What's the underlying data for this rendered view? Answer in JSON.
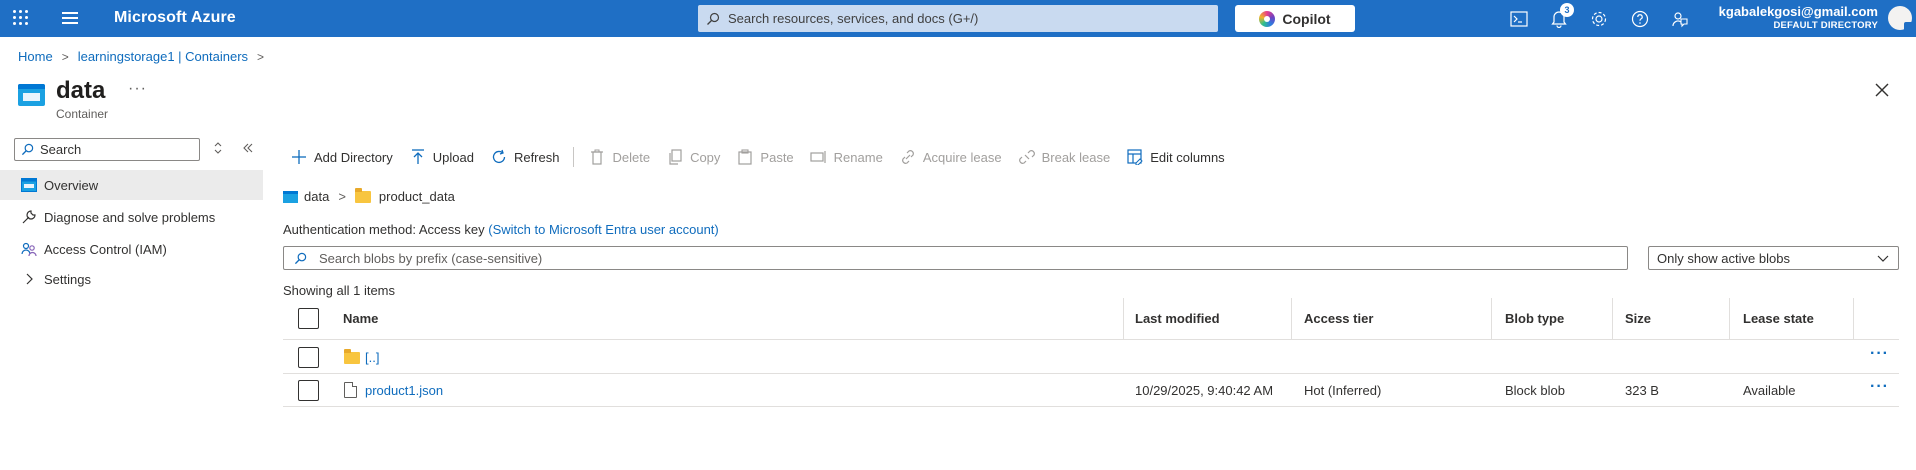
{
  "topbar": {
    "brand": "Microsoft Azure",
    "search_placeholder": "Search resources, services, and docs (G+/)",
    "copilot_label": "Copilot",
    "notification_count": "3",
    "account_email": "kgabalekgosi@gmail.com",
    "account_directory": "DEFAULT DIRECTORY"
  },
  "breadcrumb": {
    "home": "Home",
    "parent": "learningstorage1 | Containers"
  },
  "page": {
    "title": "data",
    "subtitle": "Container",
    "more": "···"
  },
  "sidebar": {
    "search_placeholder": "Search",
    "items": [
      {
        "label": "Overview",
        "icon": "overview-icon",
        "active": true
      },
      {
        "label": "Diagnose and solve problems",
        "icon": "wrench-icon"
      },
      {
        "label": "Access Control (IAM)",
        "icon": "people-icon"
      },
      {
        "label": "Settings",
        "icon": "chevron-right-icon"
      }
    ]
  },
  "toolbar": {
    "add_directory": "Add Directory",
    "upload": "Upload",
    "refresh": "Refresh",
    "delete": "Delete",
    "copy": "Copy",
    "paste": "Paste",
    "rename": "Rename",
    "acquire_lease": "Acquire lease",
    "break_lease": "Break lease",
    "edit_columns": "Edit columns"
  },
  "path": {
    "container": "data",
    "folder": "product_data"
  },
  "auth": {
    "label": "Authentication method:",
    "value": "Access key",
    "switch_link": "(Switch to Microsoft Entra user account)"
  },
  "blob_search": {
    "placeholder": "Search blobs by prefix (case-sensitive)"
  },
  "filter": {
    "selected": "Only show active blobs"
  },
  "showing": "Showing all 1 items",
  "table": {
    "columns": [
      "Name",
      "Last modified",
      "Access tier",
      "Blob type",
      "Size",
      "Lease state"
    ],
    "rows": [
      {
        "name": "[..]",
        "type": "folder",
        "last_modified": "",
        "access_tier": "",
        "blob_type": "",
        "size": "",
        "lease_state": ""
      },
      {
        "name": "product1.json",
        "type": "file",
        "last_modified": "10/29/2025, 9:40:42 AM",
        "access_tier": "Hot (Inferred)",
        "blob_type": "Block blob",
        "size": "323 B",
        "lease_state": "Available"
      }
    ],
    "row_more": "···"
  },
  "colors": {
    "topbar": "#1f6fc5",
    "link": "#0f6cbd",
    "active_nav": "#ebebeb"
  }
}
